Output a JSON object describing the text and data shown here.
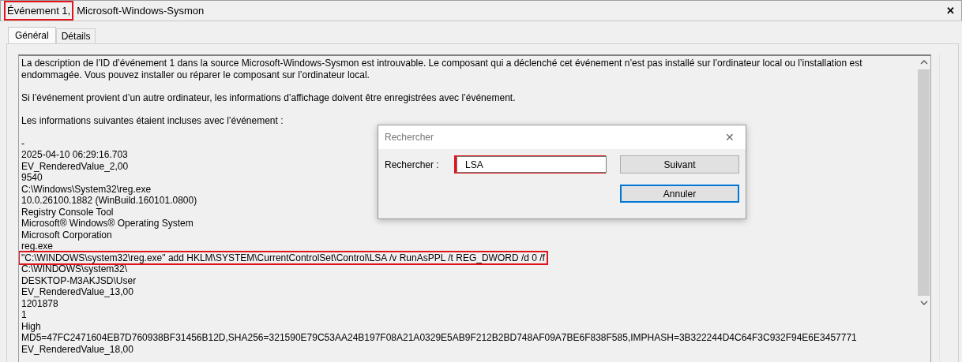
{
  "window": {
    "title_parts": [
      {
        "text": "Événement 1,",
        "highlighted": true
      },
      {
        "text": "Microsoft-Windows-Sysmon",
        "highlighted": false
      }
    ],
    "close": "✕"
  },
  "tabs": [
    {
      "label": "Général",
      "selected": true
    },
    {
      "label": "Détails",
      "selected": false
    }
  ],
  "description": {
    "paragraphs": [
      {
        "lines": [
          {
            "text": "La description de l’ID d’événement 1 dans la source Microsoft-Windows-Sysmon est introuvable. Le composant qui a déclenché cet événement n’est pas installé sur l’ordinateur local ou l’installation est",
            "highlighted": false
          },
          {
            "text": "endommagée. Vous pouvez installer ou réparer le composant sur l’ordinateur local.",
            "highlighted": false
          }
        ]
      },
      {
        "lines": [
          {
            "text": "Si l’événement provient d’un autre ordinateur, les informations d’affichage doivent être enregistrées avec l’événement.",
            "highlighted": false
          }
        ]
      },
      {
        "lines": [
          {
            "text": "Les informations suivantes étaient incluses avec l’événement :",
            "highlighted": false
          }
        ]
      },
      {
        "lines": [
          {
            "text": "-",
            "highlighted": false
          },
          {
            "text": "2025-04-10 06:29:16.703",
            "highlighted": false
          },
          {
            "text": "EV_RenderedValue_2,00",
            "highlighted": false
          },
          {
            "text": "9540",
            "highlighted": false
          },
          {
            "text": "C:\\Windows\\System32\\reg.exe",
            "highlighted": false
          },
          {
            "text": "10.0.26100.1882 (WinBuild.160101.0800)",
            "highlighted": false
          },
          {
            "text": "Registry Console Tool",
            "highlighted": false
          },
          {
            "text": "Microsoft® Windows® Operating System",
            "highlighted": false
          },
          {
            "text": "Microsoft Corporation",
            "highlighted": false
          },
          {
            "text": "reg.exe",
            "highlighted": false
          },
          {
            "text": "\"C:\\WINDOWS\\system32\\reg.exe\" add HKLM\\SYSTEM\\CurrentControlSet\\Control\\LSA /v RunAsPPL /t REG_DWORD /d 0 /f",
            "highlighted": true
          },
          {
            "text": "C:\\WINDOWS\\system32\\",
            "highlighted": false
          },
          {
            "text": "DESKTOP-M3AKJSD\\User",
            "highlighted": false
          },
          {
            "text": "EV_RenderedValue_13,00",
            "highlighted": false
          },
          {
            "text": "1201878",
            "highlighted": false
          },
          {
            "text": "1",
            "highlighted": false
          },
          {
            "text": "High",
            "highlighted": false
          },
          {
            "text": "MD5=47FC2471604EB7D760938BF31456B12D,SHA256=321590E79C53AA24B197F08A21A0329E5AB9F212B2BD748AF09A7BE6F838F585,IMPHASH=3B322244D4C64F3C932F94E6E3457771",
            "highlighted": false
          },
          {
            "text": "EV_RenderedValue_18,00",
            "highlighted": false
          }
        ]
      }
    ]
  },
  "find_dialog": {
    "title": "Rechercher",
    "close": "✕",
    "label": "Rechercher :",
    "value": "LSA",
    "value_highlighted": true,
    "buttons": [
      {
        "label": "Suivant",
        "focused": false
      },
      {
        "label": "Annuler",
        "focused": true
      }
    ]
  }
}
